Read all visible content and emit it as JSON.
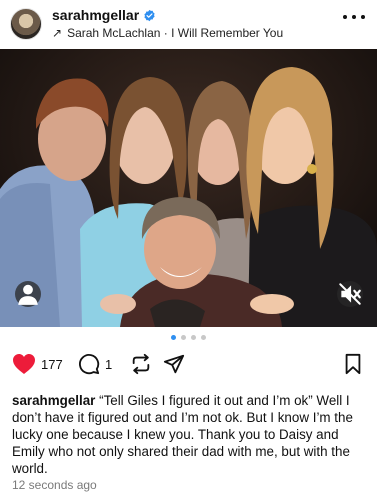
{
  "post": {
    "username": "sarahmgellar",
    "verified": true,
    "audio_title": "Sarah McLachlan · I Will Remember You",
    "more_icon": "more-horizontal-icon"
  },
  "carousel": {
    "total_slides": 4,
    "active_index": 0
  },
  "actions": {
    "likes_count": "177",
    "comments_count": "1",
    "liked": true,
    "like_color": "#ed1c3a"
  },
  "caption": {
    "username": "sarahmgellar",
    "text": "“Tell Giles I figured it out and I’m ok” Well I don’t have it figured out and I’m not ok. But I know I’m the lucky one because I knew you. Thank you to Daisy and Emily who not only shared their dad with me, but with the world."
  },
  "timestamp": "12 seconds ago",
  "colors": {
    "verified_blue": "#2f8ff0",
    "active_dot": "#2f8ff0"
  }
}
